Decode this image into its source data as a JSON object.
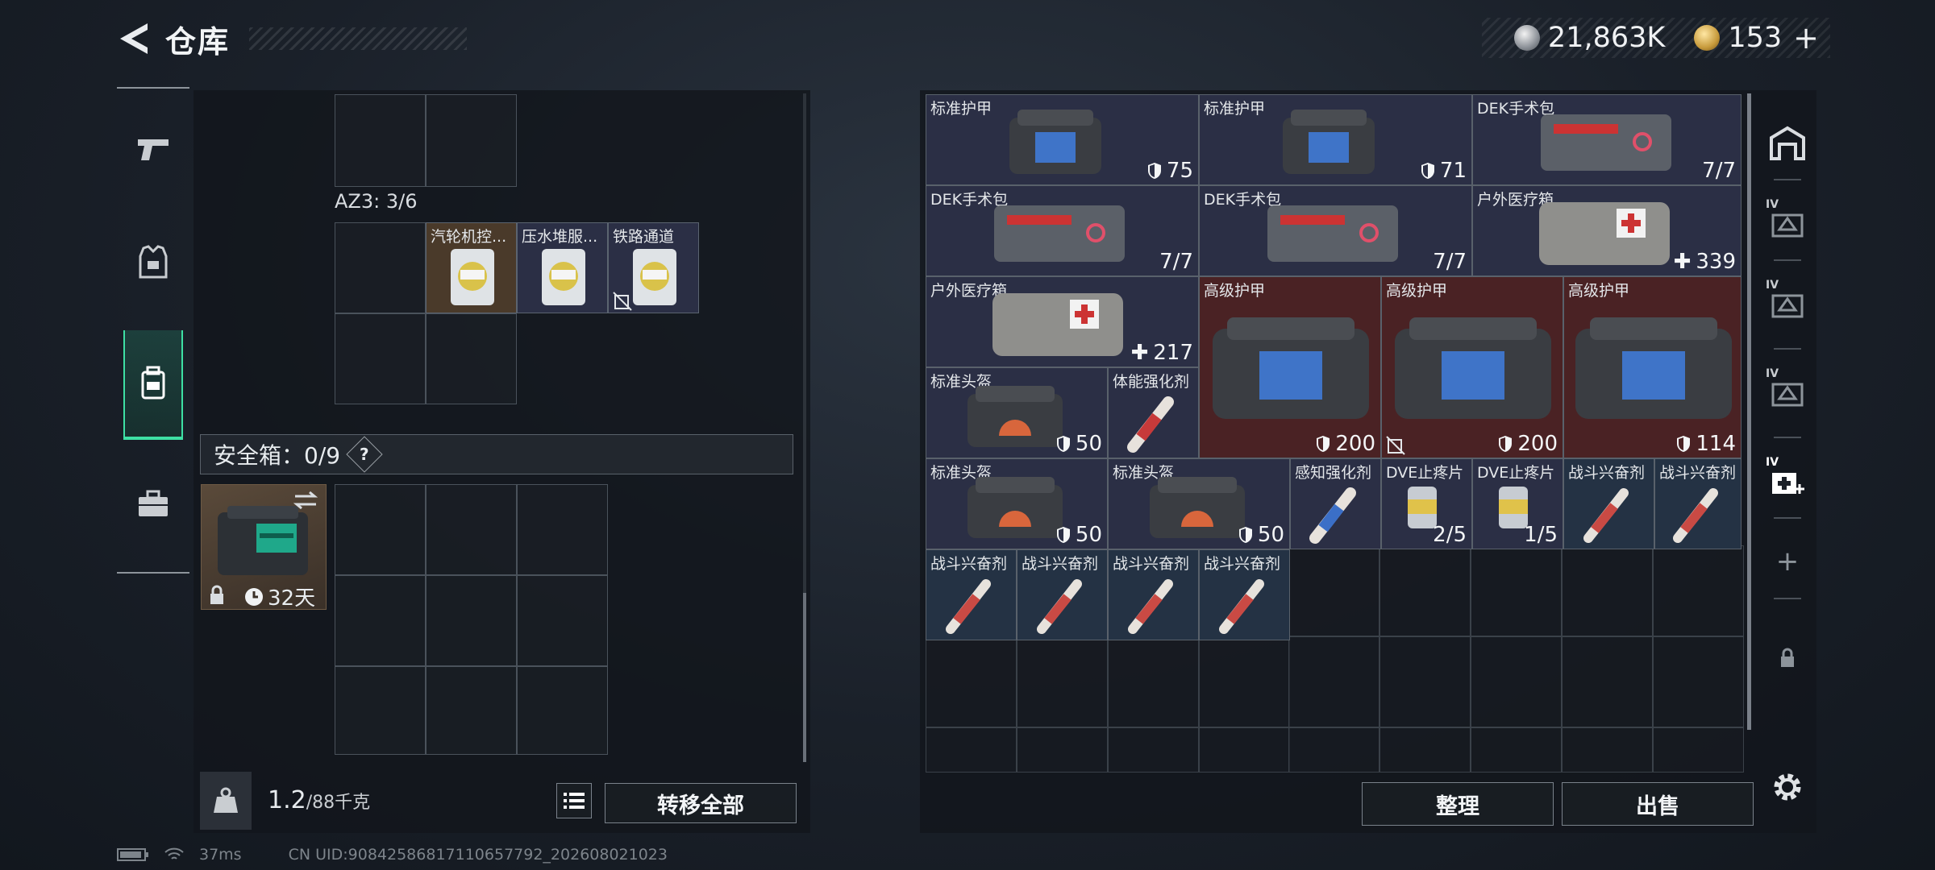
{
  "header": {
    "title": "仓库"
  },
  "currency": {
    "silver": "21,863K",
    "gold": "153",
    "plus": "+"
  },
  "left_panel": {
    "az3_label": "AZ3: 3/6",
    "az3_items": [
      {
        "name": "汽轮机控...",
        "bg": "brown"
      },
      {
        "name": "压水堆服...",
        "bg": "navy"
      },
      {
        "name": "铁路通道",
        "bg": "navy"
      }
    ],
    "safe_box": {
      "label": "安全箱：0/9",
      "help": "?",
      "duration": "32天"
    },
    "weight": {
      "current": "1.2",
      "max": "/88千克"
    },
    "transfer_all_label": "转移全部"
  },
  "storage": {
    "items": [
      {
        "name": "标准护甲",
        "value": "75",
        "icon": "shield"
      },
      {
        "name": "标准护甲",
        "value": "71",
        "icon": "shield"
      },
      {
        "name": "DEK手术包",
        "value": "7/7",
        "icon": ""
      },
      {
        "name": "DEK手术包",
        "value": "7/7",
        "icon": ""
      },
      {
        "name": "DEK手术包",
        "value": "7/7",
        "icon": ""
      },
      {
        "name": "户外医疗箱",
        "value": "339",
        "icon": "plus"
      },
      {
        "name": "户外医疗箱",
        "value": "217",
        "icon": "plus"
      },
      {
        "name": "高级护甲",
        "value": "200",
        "icon": "shield"
      },
      {
        "name": "高级护甲",
        "value": "200",
        "icon": "shield"
      },
      {
        "name": "高级护甲",
        "value": "114",
        "icon": "shield"
      },
      {
        "name": "标准头盔",
        "value": "50",
        "icon": "shield"
      },
      {
        "name": "体能强化剂",
        "value": "",
        "icon": ""
      },
      {
        "name": "标准头盔",
        "value": "50",
        "icon": "shield"
      },
      {
        "name": "标准头盔",
        "value": "50",
        "icon": "shield"
      },
      {
        "name": "感知强化剂",
        "value": "",
        "icon": ""
      },
      {
        "name": "DVE止疼片",
        "value": "2/5",
        "icon": ""
      },
      {
        "name": "DVE止疼片",
        "value": "1/5",
        "icon": ""
      },
      {
        "name": "战斗兴奋剂",
        "value": "",
        "icon": ""
      },
      {
        "name": "战斗兴奋剂",
        "value": "",
        "icon": ""
      },
      {
        "name": "战斗兴奋剂",
        "value": "",
        "icon": ""
      },
      {
        "name": "战斗兴奋剂",
        "value": "",
        "icon": ""
      },
      {
        "name": "战斗兴奋剂",
        "value": "",
        "icon": ""
      },
      {
        "name": "战斗兴奋剂",
        "value": "",
        "icon": ""
      }
    ],
    "sort_label": "整理",
    "sell_label": "出售"
  },
  "sidebar_right": {
    "tab_tag": "IV",
    "add_label": "+"
  },
  "status_bar": {
    "ping": "37ms",
    "uid": "CN UID:90842586817110657792_202608021023"
  },
  "colors": {
    "accent": "#3ee0a4",
    "rare_red": "#4a2224",
    "uncommon_navy": "#2b2f45",
    "consumable_blue": "#243244"
  }
}
